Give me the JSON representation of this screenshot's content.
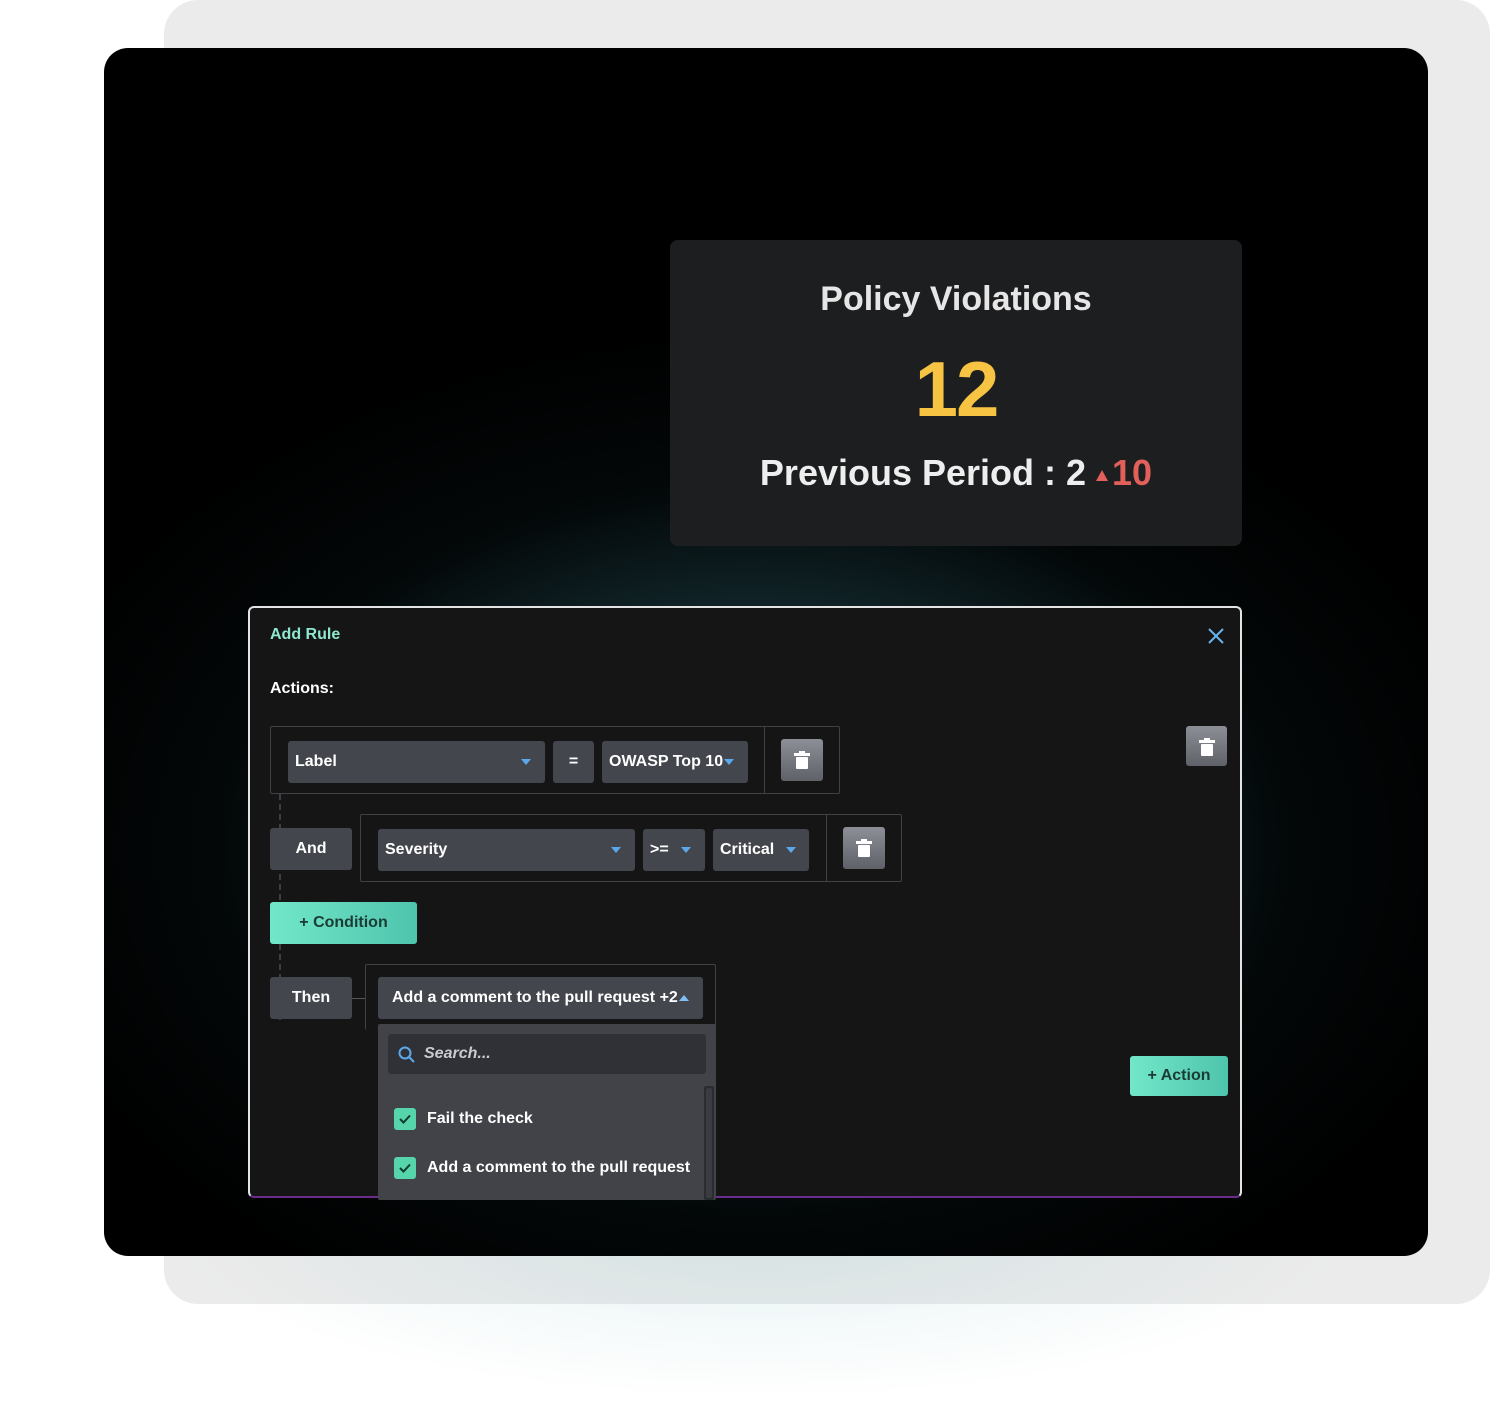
{
  "metric": {
    "title": "Policy Violations",
    "value": "12",
    "previous_label": "Previous Period : 2",
    "delta": "10",
    "colors": {
      "value": "#f6c343",
      "delta": "#e1605a"
    }
  },
  "modal": {
    "title": "Add Rule",
    "actions_label": "Actions:",
    "condition_1": {
      "field": "Label",
      "operator": "=",
      "value": "OWASP Top 10"
    },
    "and_label": "And",
    "condition_2": {
      "field": "Severity",
      "operator": ">=",
      "value": "Critical"
    },
    "add_condition_label": "+ Condition",
    "then_label": "Then",
    "then_action": "Add a comment to the pull request +2",
    "search_placeholder": "Search...",
    "options": [
      {
        "label": "Fail the check",
        "checked": true
      },
      {
        "label": "Add a comment to the pull request",
        "checked": true
      }
    ],
    "add_action_label": "+ Action",
    "colors": {
      "accent": "#72e7c8",
      "title": "#8ee8cf",
      "caret": "#5aa9ec"
    }
  },
  "icons": {
    "close": "close-icon",
    "delete": "trash-icon",
    "search": "search-icon",
    "check": "check-icon",
    "caret": "chevron-down-icon"
  }
}
